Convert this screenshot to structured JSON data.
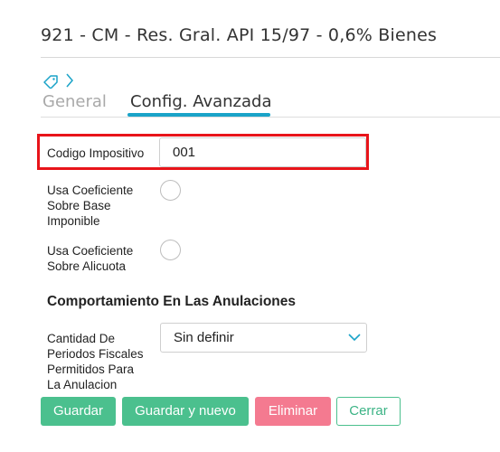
{
  "header": {
    "title": "921 - CM - Res. Gral. API 15/97 - 0,6% Bienes"
  },
  "breadcrumb": {
    "icons": [
      "tag-icon",
      "chevron-right-icon"
    ]
  },
  "tabs": [
    {
      "label": "General",
      "active": false
    },
    {
      "label": "Config. Avanzada",
      "active": true
    }
  ],
  "form": {
    "codigo_impositivo": {
      "label": "Codigo Impositivo",
      "value": "001"
    },
    "usa_coef_base": {
      "label_lines": [
        "Usa Coeficiente",
        "Sobre Base",
        "Imponible"
      ],
      "checked": false
    },
    "usa_coef_alicuota": {
      "label_lines": [
        "Usa Coeficiente",
        "Sobre Alicuota"
      ],
      "checked": false
    },
    "section_title": "Comportamiento En Las Anulaciones",
    "cantidad_periodos": {
      "label_lines": [
        "Cantidad De",
        "Periodos Fiscales",
        "Permitidos Para",
        "La Anulacion"
      ],
      "selected": "Sin definir"
    }
  },
  "buttons": {
    "guardar": "Guardar",
    "guardar_nuevo": "Guardar y nuevo",
    "eliminar": "Eliminar",
    "cerrar": "Cerrar"
  },
  "colors": {
    "accent": "#1aa3c8",
    "highlight_border": "#e8141a",
    "primary_button": "#4bc08e",
    "danger_button": "#f47a90"
  }
}
